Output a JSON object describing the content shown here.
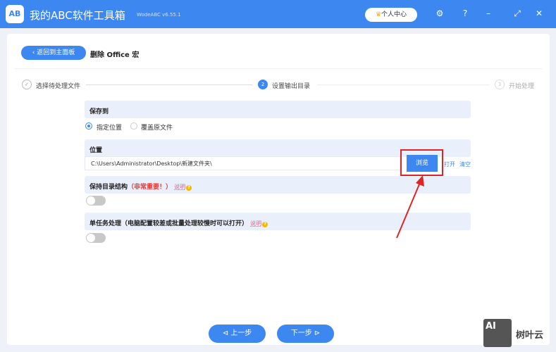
{
  "app": {
    "logo": "AB",
    "title": "我的ABC软件工具箱",
    "version": "WodeABC v6.55.1",
    "user_center": "个人中心"
  },
  "page": {
    "back": "返回到主面板",
    "title": "删除 Office 宏"
  },
  "steps": [
    {
      "num": "✓",
      "label": "选择待处理文件"
    },
    {
      "num": "2",
      "label": "设置输出目录"
    },
    {
      "num": "3",
      "label": "开始处理"
    }
  ],
  "save_to": {
    "label": "保存到",
    "options": [
      "指定位置",
      "覆盖原文件"
    ],
    "selected": 0
  },
  "location": {
    "label": "位置",
    "value": "C:\\Users\\Administrator\\Desktop\\新建文件夹\\",
    "browse": "浏览",
    "open": "打开",
    "clear": "清空"
  },
  "keep_structure": {
    "label": "保持目录结构",
    "warning": "（非常重要！）",
    "note": "说明",
    "enabled": false
  },
  "single_task": {
    "label": "单任务处理（电脑配置较差或批量处理较慢时可以打开）",
    "note": "说明",
    "enabled": false
  },
  "nav": {
    "prev": "上一步",
    "next": "下一步"
  },
  "watermark": {
    "logo": "AI",
    "text": "树叶云"
  }
}
